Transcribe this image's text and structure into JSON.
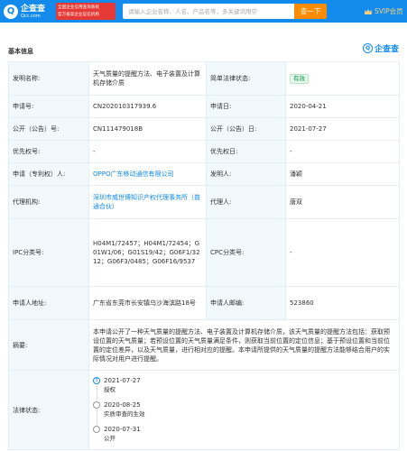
{
  "header": {
    "logo_char": "Q",
    "logo_name": "企查查",
    "logo_domain": "Qcc.com",
    "badge_lines": [
      "全国企业信用查询系统",
      "官方备案企业征信机构"
    ],
    "search_placeholder": "请输入企业名称、人名、产品名等，多关键词用空",
    "search_button": "查一下",
    "vip_label": "SVIP会员"
  },
  "section": {
    "title": "基本信息",
    "brand": "企查查",
    "brand_char": "Q"
  },
  "fields": {
    "title_label": "发明名称:",
    "title_value": "天气质量的提醒方法、电子装置及计算机存储介质",
    "status_label": "简单法律状态:",
    "status_value": "有效",
    "app_no_label": "申请号:",
    "app_no_value": "CN202010317939.6",
    "app_date_label": "申请日:",
    "app_date_value": "2020-04-21",
    "pub_no_label": "公开（公告）号:",
    "pub_no_value": "CN111479018B",
    "pub_date_label": "公开（公告）日:",
    "pub_date_value": "2021-07-27",
    "priority_no_label": "优先权号:",
    "priority_no_value": "-",
    "priority_date_label": "优先权日:",
    "priority_date_value": "-",
    "applicant_label": "申请（专利权）人:",
    "applicant_value": "OPPO广东移动通信有限公司",
    "inventor_label": "发明人:",
    "inventor_value": "潘颖",
    "agency_label": "代理机构:",
    "agency_value": "深圳市威世博知识产权代理事务所（普通合伙）",
    "agent_label": "代理人:",
    "agent_value": "唐双",
    "ipc_label": "IPC分类号:",
    "ipc_value": "H04M1/72457；H04M1/72454；G01W1/06；G01S19/42；G06F1/3212；G06F3/0485；G06F16/9537",
    "cpc_label": "CPC分类号:",
    "cpc_value": "-",
    "address_label": "申请人地址:",
    "address_value": "广东省东莞市长安镇乌沙海滨路18号",
    "postcode_label": "申请人邮编:",
    "postcode_value": "523860",
    "abstract_label": "摘要:",
    "abstract_value": "本申请公开了一种天气质量的提醒方法、电子装置及计算机存储介质，该天气质量的提醒方法包括：获取预设位置的天气质量；若预设位置的天气质量满足条件，则获取当前位置的定位信息；基于预设位置和当前位置的定位差异，以及天气质量，进行相对应的提醒。本申请所提供的天气质量的提醒方法能够结合用户的实际情况对用户进行提醒。",
    "legal_label": "法律状态:"
  },
  "legal_timeline": [
    {
      "step": "3",
      "date": "2021-07-27",
      "event": "授权"
    },
    {
      "step": "",
      "date": "2020-08-25",
      "event": "实质审查的生效"
    },
    {
      "step": "",
      "date": "2020-07-31",
      "event": "公开"
    }
  ],
  "colors": {
    "brand_blue": "#128bed",
    "search_orange": "#ff8c00",
    "badge_red": "#e53935",
    "valid_green": "#009944"
  }
}
